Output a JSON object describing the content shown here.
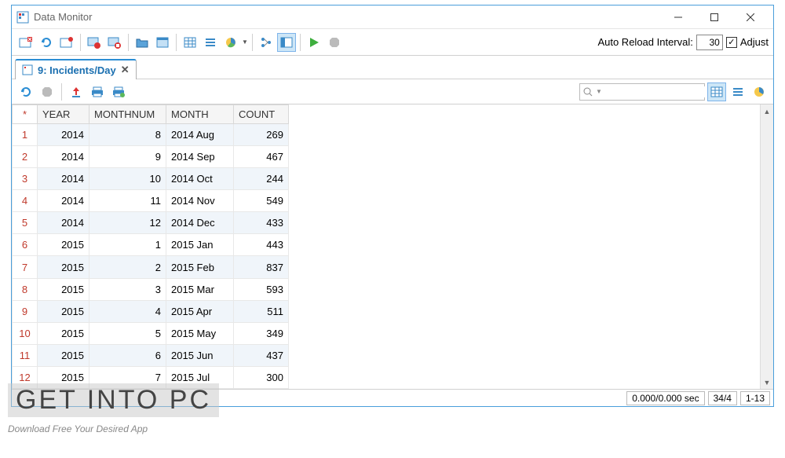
{
  "window": {
    "title": "Data Monitor"
  },
  "toolbar": {
    "reload_label": "Auto Reload Interval:",
    "reload_value": "30",
    "adjust_label": "Adjust",
    "adjust_checked": true
  },
  "tab": {
    "label": "9: Incidents/Day"
  },
  "search": {
    "placeholder": ""
  },
  "table": {
    "headers": {
      "star": "*",
      "year": "YEAR",
      "monthnum": "MONTHNUM",
      "month": "MONTH",
      "count": "COUNT"
    },
    "rows": [
      {
        "n": "1",
        "year": "2014",
        "monthnum": "8",
        "month": "2014 Aug",
        "count": "269"
      },
      {
        "n": "2",
        "year": "2014",
        "monthnum": "9",
        "month": "2014 Sep",
        "count": "467"
      },
      {
        "n": "3",
        "year": "2014",
        "monthnum": "10",
        "month": "2014 Oct",
        "count": "244"
      },
      {
        "n": "4",
        "year": "2014",
        "monthnum": "11",
        "month": "2014 Nov",
        "count": "549"
      },
      {
        "n": "5",
        "year": "2014",
        "monthnum": "12",
        "month": "2014 Dec",
        "count": "433"
      },
      {
        "n": "6",
        "year": "2015",
        "monthnum": "1",
        "month": "2015 Jan",
        "count": "443"
      },
      {
        "n": "7",
        "year": "2015",
        "monthnum": "2",
        "month": "2015 Feb",
        "count": "837"
      },
      {
        "n": "8",
        "year": "2015",
        "monthnum": "3",
        "month": "2015 Mar",
        "count": "593"
      },
      {
        "n": "9",
        "year": "2015",
        "monthnum": "4",
        "month": "2015 Apr",
        "count": "511"
      },
      {
        "n": "10",
        "year": "2015",
        "monthnum": "5",
        "month": "2015 May",
        "count": "349"
      },
      {
        "n": "11",
        "year": "2015",
        "monthnum": "6",
        "month": "2015 Jun",
        "count": "437"
      },
      {
        "n": "12",
        "year": "2015",
        "monthnum": "7",
        "month": "2015 Jul",
        "count": "300"
      }
    ]
  },
  "status": {
    "time": "0.000/0.000 sec",
    "mid": "34/4",
    "range": "1-13"
  },
  "watermark": {
    "title": "GET INTO PC",
    "subtitle": "Download Free Your Desired App"
  },
  "icons": {
    "grid": "grid-icon",
    "refresh": "refresh-icon",
    "calendar": "calendar-icon",
    "record_start": "record-start-icon",
    "record_stop": "record-stop-icon",
    "folder": "folder-icon",
    "window": "window-icon",
    "table": "table-icon",
    "list": "list-icon",
    "pie": "pie-icon",
    "tree": "tree-icon",
    "layout": "layout-icon",
    "play": "play-icon",
    "stop": "stop-icon",
    "reload": "reload-icon",
    "upload": "upload-icon",
    "print": "print-icon",
    "print2": "print-preview-icon",
    "search": "search-icon",
    "globe": "globe-icon"
  }
}
